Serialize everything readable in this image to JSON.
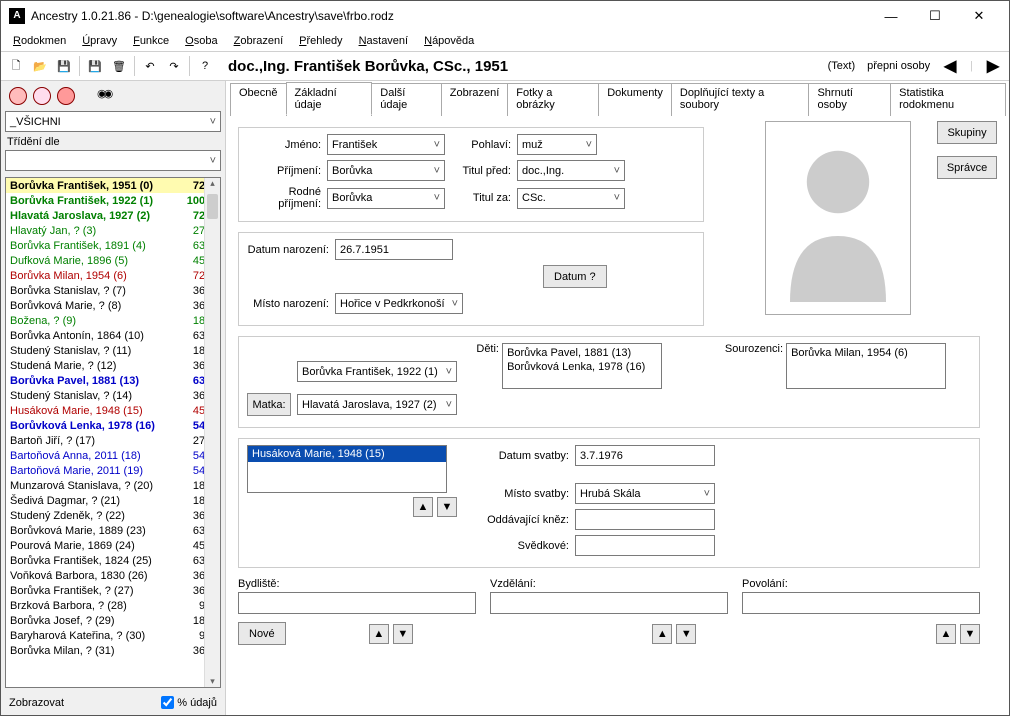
{
  "window": {
    "title": "Ancestry 1.0.21.86 - D:\\genealogie\\software\\Ancestry\\save\\frbo.rodz",
    "min": "—",
    "max": "☐",
    "close": "✕"
  },
  "menu": [
    "Rodokmen",
    "Úpravy",
    "Funkce",
    "Osoba",
    "Zobrazení",
    "Přehledy",
    "Nastavení",
    "Nápověda"
  ],
  "header": {
    "title": "doc.,Ing. František Borůvka, CSc., 1951",
    "text_link": "(Text)",
    "switch": "přepni osoby"
  },
  "sidebar": {
    "filter": "_VŠICHNI",
    "sort_label": "Třídění dle",
    "zobrazovat": "Zobrazovat",
    "pct_label": "% údajů",
    "people": [
      {
        "name": "Borůvka František, 1951 (0)",
        "pct": "72 %",
        "cls": "p-black p-bold p-sel"
      },
      {
        "name": "Borůvka František, 1922 (1)",
        "pct": "100 %",
        "cls": "p-green p-bold"
      },
      {
        "name": "Hlavatá Jaroslava, 1927 (2)",
        "pct": "72 %",
        "cls": "p-green p-bold"
      },
      {
        "name": "Hlavatý Jan, ? (3)",
        "pct": "27 %",
        "cls": "p-green"
      },
      {
        "name": "Borůvka František, 1891 (4)",
        "pct": "63 %",
        "cls": "p-green"
      },
      {
        "name": "Dufková Marie, 1896 (5)",
        "pct": "45 %",
        "cls": "p-green"
      },
      {
        "name": "Borůvka Milan, 1954 (6)",
        "pct": "72 %",
        "cls": "p-red"
      },
      {
        "name": "Borůvka Stanislav, ? (7)",
        "pct": "36 %",
        "cls": "p-black"
      },
      {
        "name": "Borůvková Marie, ? (8)",
        "pct": "36 %",
        "cls": "p-black"
      },
      {
        "name": "Božena, ? (9)",
        "pct": "18 %",
        "cls": "p-green"
      },
      {
        "name": "Borůvka Antonín, 1864 (10)",
        "pct": "63 %",
        "cls": "p-black"
      },
      {
        "name": "Studený Stanislav, ? (11)",
        "pct": "18 %",
        "cls": "p-black"
      },
      {
        "name": "Studená Marie, ? (12)",
        "pct": "36 %",
        "cls": "p-black"
      },
      {
        "name": "Borůvka Pavel, 1881 (13)",
        "pct": "63 %",
        "cls": "p-blue p-bold"
      },
      {
        "name": "Studený Stanislav, ? (14)",
        "pct": "36 %",
        "cls": "p-black"
      },
      {
        "name": "Husáková Marie, 1948 (15)",
        "pct": "45 %",
        "cls": "p-red"
      },
      {
        "name": "Borůvková Lenka, 1978 (16)",
        "pct": "54 %",
        "cls": "p-blue p-bold"
      },
      {
        "name": "Bartoň Jiří, ? (17)",
        "pct": "27 %",
        "cls": "p-black"
      },
      {
        "name": "Bartoňová Anna, 2011 (18)",
        "pct": "54 %",
        "cls": "p-blue"
      },
      {
        "name": "Bartoňová Marie, 2011 (19)",
        "pct": "54 %",
        "cls": "p-blue"
      },
      {
        "name": "Munzarová Stanislava, ? (20)",
        "pct": "18 %",
        "cls": "p-black"
      },
      {
        "name": "Šedivá Dagmar, ? (21)",
        "pct": "18 %",
        "cls": "p-black"
      },
      {
        "name": "Studený Zdeněk, ? (22)",
        "pct": "36 %",
        "cls": "p-black"
      },
      {
        "name": "Borůvková Marie, 1889 (23)",
        "pct": "63 %",
        "cls": "p-black"
      },
      {
        "name": "Pourová Marie, 1869 (24)",
        "pct": "45 %",
        "cls": "p-black"
      },
      {
        "name": "Borůvka František, 1824 (25)",
        "pct": "63 %",
        "cls": "p-black"
      },
      {
        "name": "Voňková Barbora, 1830 (26)",
        "pct": "36 %",
        "cls": "p-black"
      },
      {
        "name": "Borůvka František, ? (27)",
        "pct": "36 %",
        "cls": "p-black"
      },
      {
        "name": "Brzková Barbora, ? (28)",
        "pct": "9 %",
        "cls": "p-black"
      },
      {
        "name": "Borůvka Josef, ? (29)",
        "pct": "18 %",
        "cls": "p-black"
      },
      {
        "name": "Baryharová Kateřina, ? (30)",
        "pct": "9 %",
        "cls": "p-black"
      },
      {
        "name": "Borůvka Milan, ? (31)",
        "pct": "36 %",
        "cls": "p-black"
      }
    ]
  },
  "tabs": [
    "Obecně",
    "Základní údaje",
    "Další údaje",
    "Zobrazení",
    "Fotky a obrázky",
    "Dokumenty",
    "Doplňující texty a soubory",
    "Shrnutí osoby",
    "Statistika rodokmenu"
  ],
  "active_tab": 1,
  "form": {
    "labels": {
      "jmeno": "Jméno:",
      "prijmeni": "Příjmení:",
      "rodne": "Rodné příjmení:",
      "pohlavi": "Pohlaví:",
      "titul_pred": "Titul před:",
      "titul_za": "Titul za:",
      "datum_nar": "Datum narození:",
      "datum_btn": "Datum ?",
      "misto_nar": "Místo narození:",
      "matka": "Matka:",
      "deti": "Děti:",
      "sourozenci": "Sourozenci:",
      "datum_svatby": "Datum svatby:",
      "misto_svatby": "Místo svatby:",
      "knez": "Oddávající kněz:",
      "svedkove": "Svědkové:",
      "bydliste": "Bydliště:",
      "vzdelani": "Vzdělání:",
      "povolani": "Povolání:",
      "nove": "Nové",
      "skupiny": "Skupiny",
      "spravce": "Správce"
    },
    "values": {
      "jmeno": "František",
      "prijmeni": "Borůvka",
      "rodne": "Borůvka",
      "pohlavi": "muž",
      "titul_pred": "doc.,Ing.",
      "titul_za": "CSc.",
      "datum_nar": "26.7.1951",
      "misto_nar": "Hořice v Pedkrkonoší",
      "otec": "Borůvka František, 1922 (1)",
      "matka": "Hlavatá Jaroslava, 1927 (2)",
      "deti1": "Borůvka Pavel, 1881 (13)",
      "deti2": "Borůvková Lenka, 1978 (16)",
      "sourozenci1": "Borůvka Milan, 1954 (6)",
      "manzelka": "Husáková Marie, 1948 (15)",
      "datum_svatby": "3.7.1976",
      "misto_svatby": "Hrubá Skála",
      "knez": "",
      "svedkove": "",
      "bydliste": "",
      "vzdelani": "",
      "povolani": ""
    }
  }
}
